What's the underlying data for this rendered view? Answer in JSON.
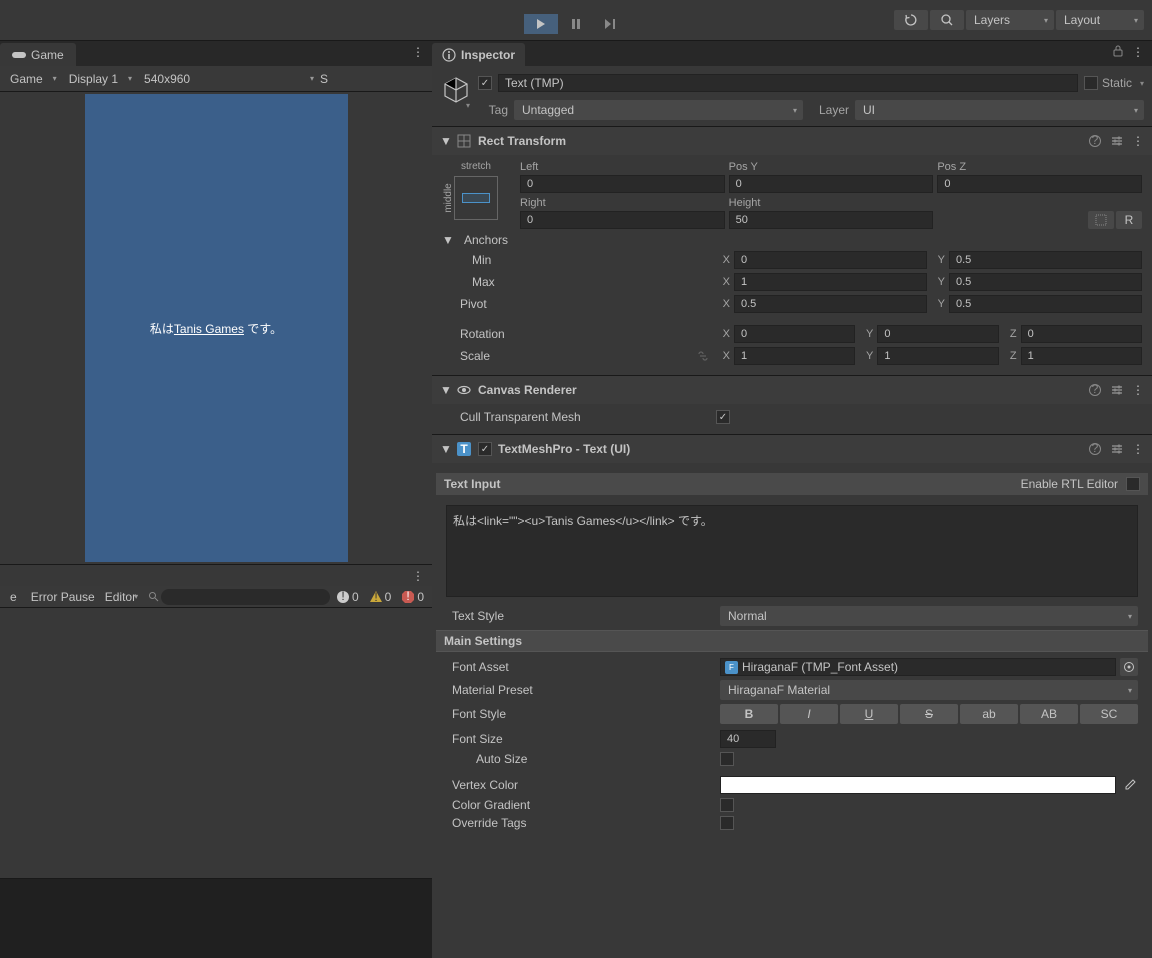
{
  "toolbar": {
    "layers": "Layers",
    "layout": "Layout"
  },
  "gameTab": {
    "label": "Game",
    "mode": "Game",
    "display": "Display 1",
    "resolution": "540x960",
    "scale_partial": "S"
  },
  "gamePreview": {
    "prefix": "私は",
    "link": "Tanis Games",
    "suffix": " です。"
  },
  "console": {
    "clear_partial": "e",
    "error_pause": "Error Pause",
    "editor": "Editor",
    "info_count": "0",
    "warn_count": "0",
    "error_count": "0"
  },
  "inspector": {
    "tab_label": "Inspector",
    "obj_name": "Text (TMP)",
    "static_label": "Static",
    "tag_label": "Tag",
    "tag_value": "Untagged",
    "layer_label": "Layer",
    "layer_value": "UI"
  },
  "rectTransform": {
    "title": "Rect Transform",
    "preset": "stretch",
    "preset_v": "middle",
    "left_label": "Left",
    "left": "0",
    "posy_label": "Pos Y",
    "posy": "0",
    "posz_label": "Pos Z",
    "posz": "0",
    "right_label": "Right",
    "right": "0",
    "height_label": "Height",
    "height": "50",
    "anchors_label": "Anchors",
    "min_label": "Min",
    "min_x": "0",
    "min_y": "0.5",
    "max_label": "Max",
    "max_x": "1",
    "max_y": "0.5",
    "pivot_label": "Pivot",
    "pivot_x": "0.5",
    "pivot_y": "0.5",
    "rotation_label": "Rotation",
    "rot_x": "0",
    "rot_y": "0",
    "rot_z": "0",
    "scale_label": "Scale",
    "scale_x": "1",
    "scale_y": "1",
    "scale_z": "1",
    "r_btn": "R"
  },
  "canvasRenderer": {
    "title": "Canvas Renderer",
    "cull_label": "Cull Transparent Mesh"
  },
  "tmp": {
    "title": "TextMeshPro - Text (UI)",
    "text_input_label": "Text Input",
    "rtl_label": "Enable RTL Editor",
    "text_value": "私は<link=\"\"><u>Tanis Games</u></link> です。",
    "text_style_label": "Text Style",
    "text_style_value": "Normal",
    "main_settings": "Main Settings",
    "font_asset_label": "Font Asset",
    "font_asset_value": "HiraganaF (TMP_Font Asset)",
    "font_asset_badge": "F",
    "material_label": "Material Preset",
    "material_value": "HiraganaF Material",
    "font_style_label": "Font Style",
    "style_b": "B",
    "style_i": "I",
    "style_u": "U",
    "style_s": "S",
    "style_ab": "ab",
    "style_AB": "AB",
    "style_sc": "SC",
    "font_size_label": "Font Size",
    "font_size_value": "40",
    "auto_size_label": "Auto Size",
    "vertex_color_label": "Vertex Color",
    "color_gradient_label": "Color Gradient",
    "override_tags_label": "Override Tags"
  }
}
